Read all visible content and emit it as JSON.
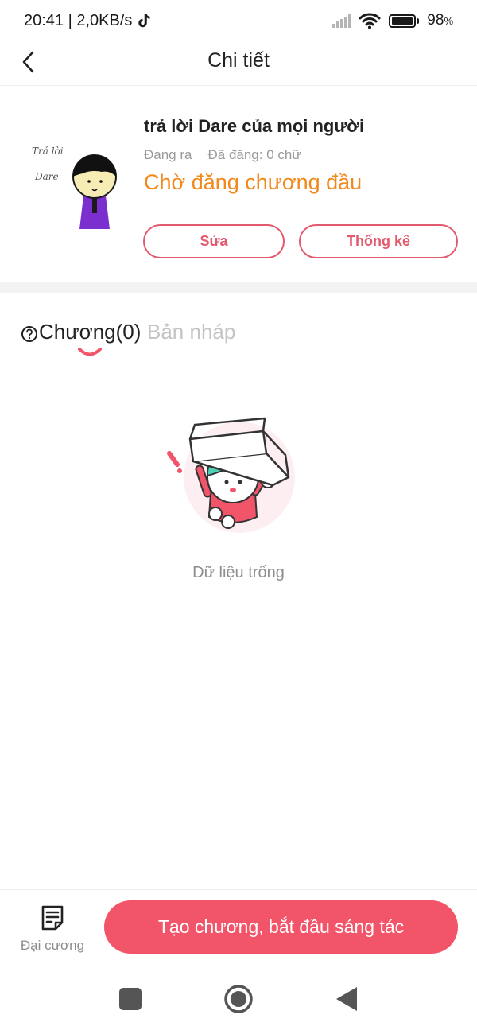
{
  "status_bar": {
    "time_speed": "20:41 | 2,0KB/s",
    "battery_percent": "98",
    "battery_unit": "%",
    "battery_level": 0.98,
    "icons": [
      "tiktok-icon",
      "signal-icon",
      "wifi-icon",
      "battery-icon"
    ]
  },
  "header": {
    "title": "Chi tiết",
    "back_icon": "chevron-left-icon"
  },
  "story": {
    "title": "trả lời Dare của mọi người",
    "state": "Đang ra",
    "word_count": "Đã đăng: 0 chữ",
    "status": "Chờ đăng chương đầu",
    "status_color": "#f2891d",
    "cover_text_line1": "Trả lời",
    "cover_text_line2": "Dare",
    "edit_label": "Sửa",
    "stats_label": "Thống kê"
  },
  "tabs": {
    "help_icon": "question-circle-icon",
    "chapters_label": "Chương(0)",
    "drafts_label": "Bản nháp"
  },
  "empty_state": {
    "text": "Dữ liệu trống"
  },
  "bottom_bar": {
    "outline_label": "Đại cương",
    "outline_icon": "document-list-icon",
    "create_label": "Tạo chương, bắt đầu sáng tác",
    "accent_color": "#f25469"
  },
  "nav": {
    "icons": [
      "recent-apps-icon",
      "home-icon",
      "back-triangle-icon"
    ]
  }
}
